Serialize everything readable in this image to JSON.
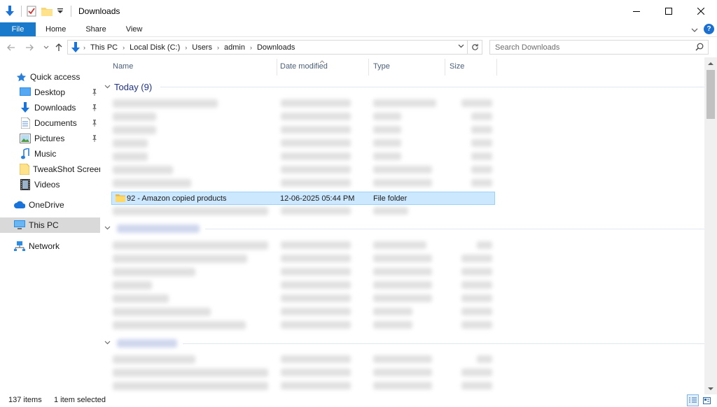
{
  "window": {
    "title": "Downloads"
  },
  "ribbon": {
    "tabs": [
      "File",
      "Home",
      "Share",
      "View"
    ]
  },
  "address": {
    "crumbs": [
      "This PC",
      "Local Disk (C:)",
      "Users",
      "admin",
      "Downloads"
    ]
  },
  "search": {
    "placeholder": "Search Downloads"
  },
  "columns": {
    "name": "Name",
    "date": "Date modified",
    "type": "Type",
    "size": "Size"
  },
  "nav": {
    "quick_access": "Quick access",
    "items": [
      "Desktop",
      "Downloads",
      "Documents",
      "Pictures",
      "Music",
      "TweakShot Screen C",
      "Videos"
    ],
    "onedrive": "OneDrive",
    "this_pc": "This PC",
    "network": "Network"
  },
  "groups": {
    "today": "Today (9)"
  },
  "selected_row": {
    "name": "92 - Amazon copied products",
    "date": "12-06-2025 05:44 PM",
    "type": "File folder"
  },
  "status": {
    "count": "137 items",
    "selection": "1 item selected"
  },
  "colors": {
    "accent": "#1979ca",
    "selection": "#cce8ff",
    "group_title": "#1e3287"
  }
}
